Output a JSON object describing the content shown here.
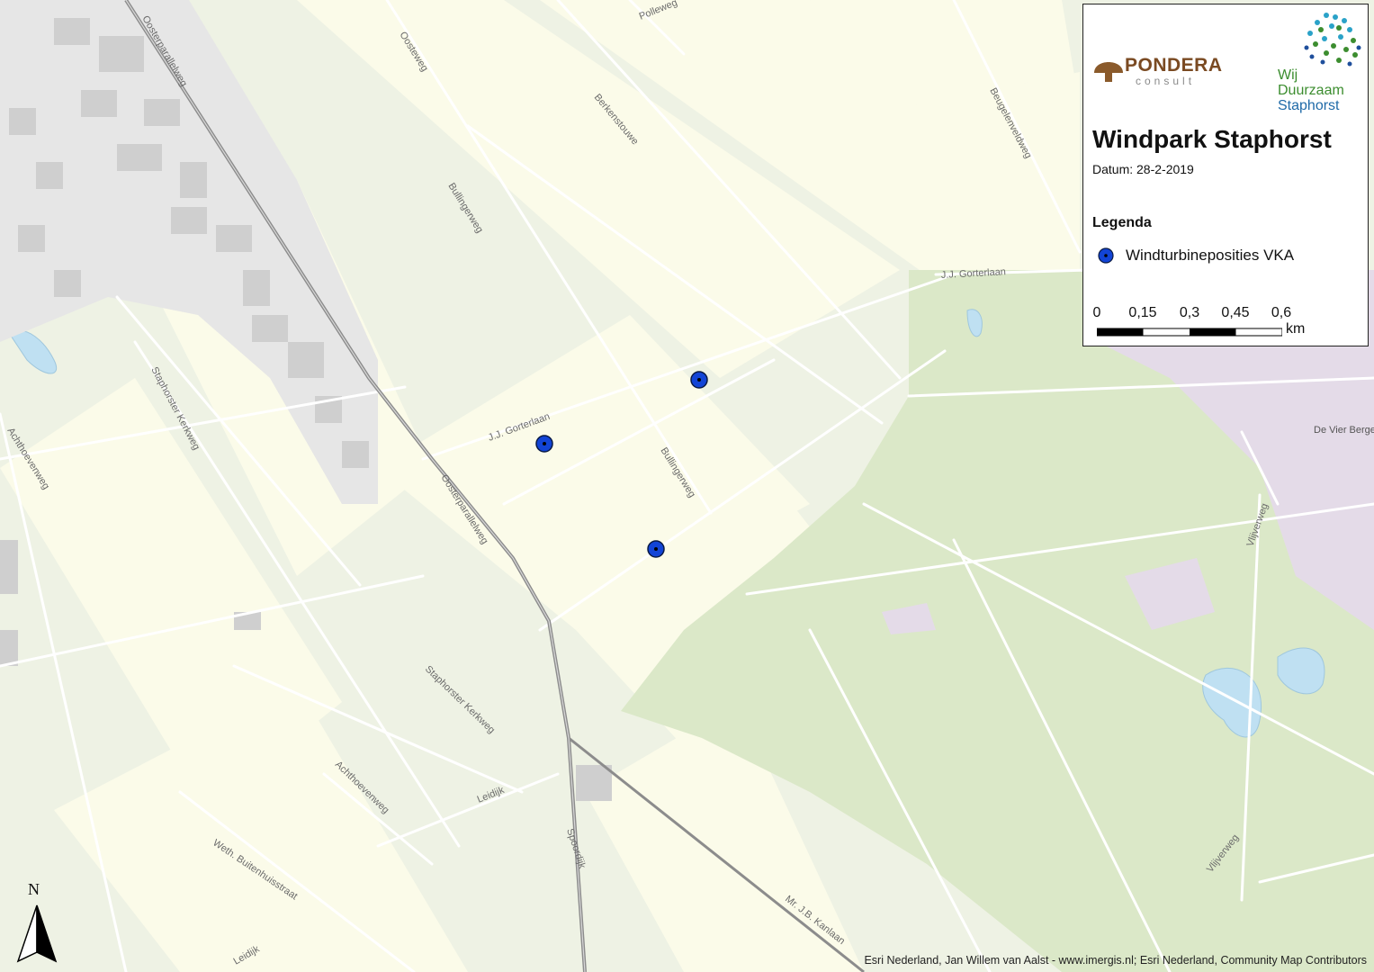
{
  "map": {
    "basemap_colors": {
      "background": "#eef2e4",
      "field_light": "#fbfbe9",
      "field_green": "#e6eedc",
      "forest": "#dbe8c8",
      "heath": "#e7dcec",
      "water": "#bfe0f2",
      "urban": "#d2d2d2",
      "road": "#ffffff",
      "railway": "#8c8c8c"
    },
    "road_labels": [
      "Oosterparallelweg",
      "Oosteweg",
      "Polleweg",
      "Berkenstouwe",
      "Beugelenveldweg",
      "Bullingerweg",
      "J.J. Gorterlaan",
      "J.J. Gorterlaan",
      "Bullingerweg",
      "Oosterparallelweg",
      "Staphorster Kerkweg",
      "Achthoevenweg",
      "Staphorster Kerkweg",
      "Achthoevenweg",
      "Leidijk",
      "Spoordijk",
      "Weth. Buitenhuisstraat",
      "Mr. J.B. Kanlaan",
      "Vlijverweg",
      "Vlijverweg",
      "Leidijk"
    ],
    "place_labels": [
      "De Vier Berge"
    ],
    "turbine_color": "#1244d6",
    "turbine_count": 3
  },
  "legend_panel": {
    "logo_pondera": {
      "name": "PONDERA",
      "sub": "consult"
    },
    "logo_wij": {
      "line1": "Wij",
      "line2": "Duurzaam",
      "line3": "Staphorst"
    },
    "title": "Windpark Staphorst",
    "date": "Datum: 28-2-2019",
    "legend_heading": "Legenda",
    "legend_items": [
      {
        "label": "Windturbineposities VKA",
        "icon": "turbine-position-icon"
      }
    ],
    "scale": {
      "ticks": [
        "0",
        "0,15",
        "0,3",
        "0,45",
        "0,6"
      ],
      "unit": "km"
    }
  },
  "north_arrow": {
    "letter": "N"
  },
  "attribution": "Esri Nederland, Jan Willem van Aalst - www.imergis.nl; Esri Nederland, Community Map Contributors"
}
